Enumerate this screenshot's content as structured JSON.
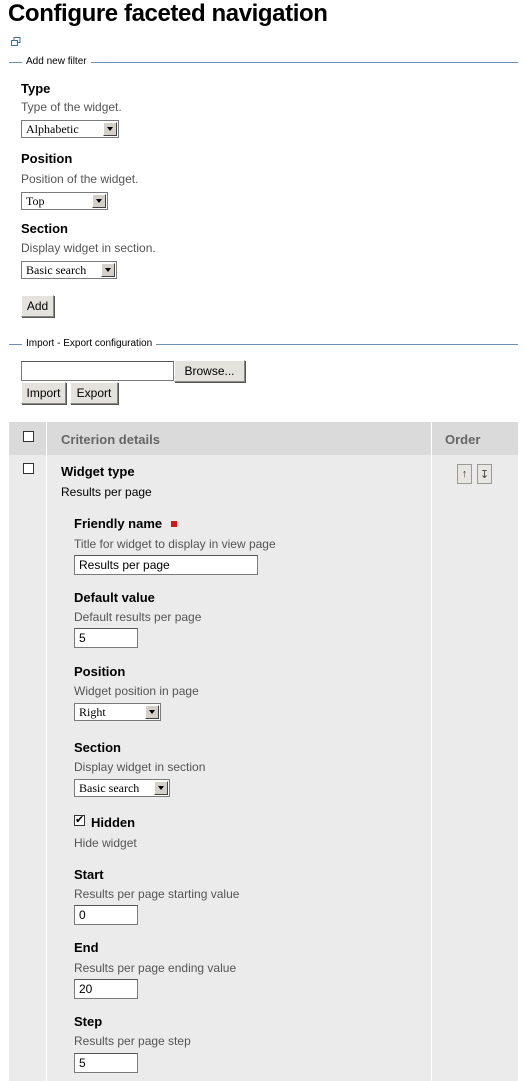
{
  "page": {
    "title": "Configure faceted navigation"
  },
  "add_filter": {
    "legend": "Add new filter",
    "type_label": "Type",
    "type_help": "Type of the widget.",
    "type_value": "Alphabetic",
    "position_label": "Position",
    "position_help": "Position of the widget.",
    "position_value": "Top",
    "section_label": "Section",
    "section_help": "Display widget in section.",
    "section_value": "Basic search",
    "add_button": "Add"
  },
  "import_export": {
    "legend": "Import - Export configuration",
    "file_value": "",
    "browse_button": "Browse...",
    "import_button": "Import",
    "export_button": "Export"
  },
  "table": {
    "header_details": "Criterion details",
    "header_order": "Order",
    "widget_type_label": "Widget type",
    "widget_type_value": "Results per page",
    "fields": {
      "friendly_name_label": "Friendly name",
      "friendly_name_help": "Title for widget to display in view page",
      "friendly_name_value": "Results per page",
      "default_label": "Default value",
      "default_help": "Default results per page",
      "default_value": "5",
      "position_label": "Position",
      "position_help": "Widget position in page",
      "position_value": "Right",
      "section_label": "Section",
      "section_help": "Display widget in section",
      "section_value": "Basic search",
      "hidden_label": "Hidden",
      "hidden_help": "Hide widget",
      "start_label": "Start",
      "start_help": "Results per page starting value",
      "start_value": "0",
      "end_label": "End",
      "end_help": "Results per page ending value",
      "end_value": "20",
      "step_label": "Step",
      "step_help": "Results per page step",
      "step_value": "5"
    }
  },
  "icons": {
    "page_icon": "external-window-icon",
    "move_up": "arrow-up-icon",
    "move_down": "arrow-down-icon",
    "required": "required-marker-icon"
  },
  "colors": {
    "legend_line": "#6b8fb3",
    "required": "#e01010",
    "table_bg": "#ebebeb",
    "table_header_bg": "#dadada"
  }
}
